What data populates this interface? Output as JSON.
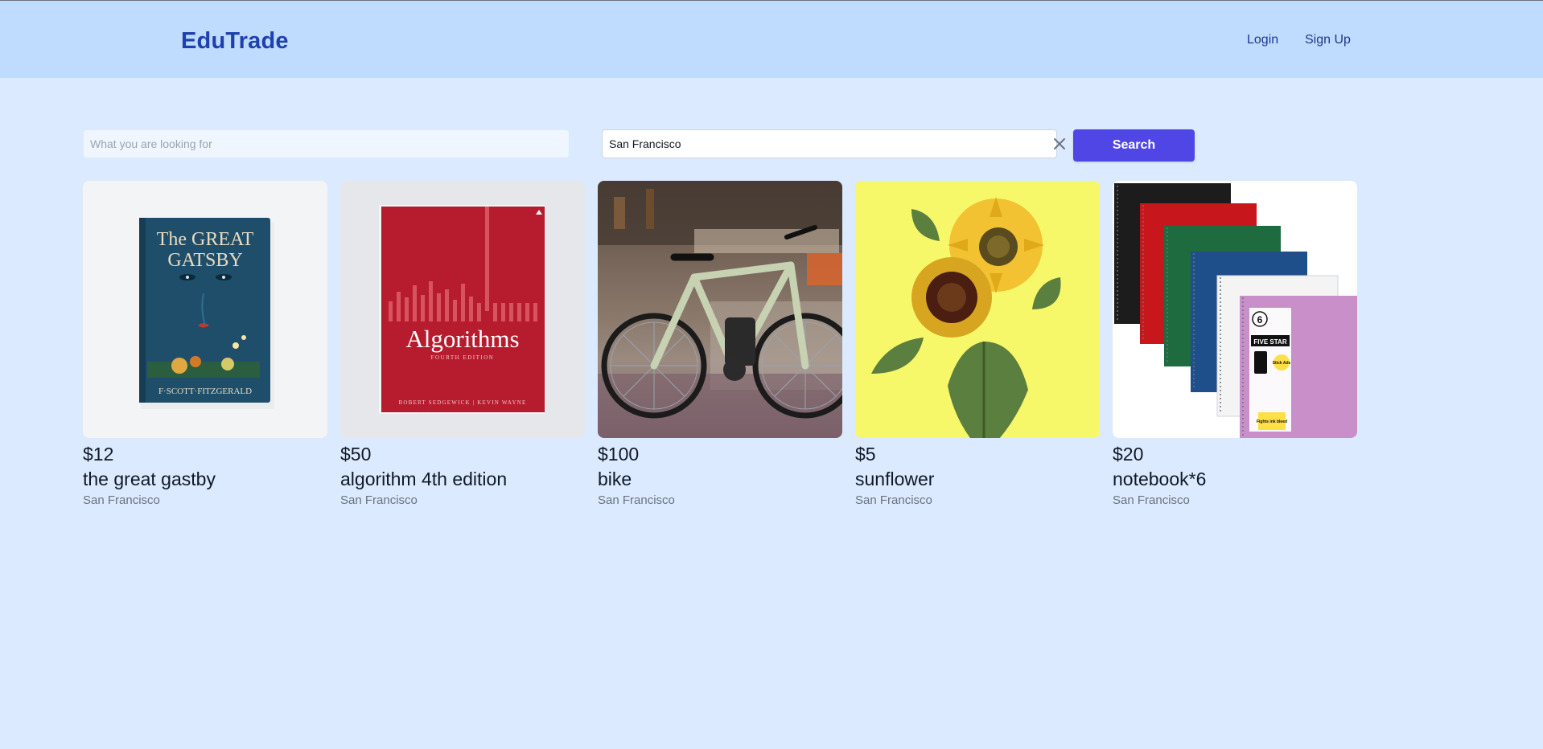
{
  "app": {
    "title": "EduTrade"
  },
  "nav": {
    "login": "Login",
    "signup": "Sign Up"
  },
  "search": {
    "query_placeholder": "What you are looking for",
    "query_value": "",
    "location_value": "San Francisco",
    "button_label": "Search"
  },
  "listings": [
    {
      "price": "$12",
      "title": "the great gastby",
      "location": "San Francisco",
      "image": "book-cover",
      "cover_text": {
        "title_line1": "The GREAT",
        "title_line2": "GATSBY",
        "author": "F·SCOTT·FITZGERALD"
      }
    },
    {
      "price": "$50",
      "title": "algorithm 4th edition",
      "location": "San Francisco",
      "image": "book-cover",
      "cover_text": {
        "title": "Algorithms",
        "edition": "FOURTH EDITION",
        "authors": "ROBERT SEDGEWICK | KEVIN WAYNE"
      }
    },
    {
      "price": "$100",
      "title": "bike",
      "location": "San Francisco",
      "image": "bicycle-photo"
    },
    {
      "price": "$5",
      "title": "sunflower",
      "location": "San Francisco",
      "image": "sunflower-photo"
    },
    {
      "price": "$20",
      "title": "notebook*6",
      "location": "San Francisco",
      "image": "notebooks-photo",
      "cover_text": {
        "badge": "6",
        "brand": "FIVE STAR",
        "feature": "Stick Ads",
        "callout": "Fights ink bleed"
      }
    }
  ],
  "colors": {
    "page_bg": "#dbeafe",
    "header_bg": "#bfdbfe",
    "logo": "#1e40af",
    "accent": "#4f46e5"
  }
}
